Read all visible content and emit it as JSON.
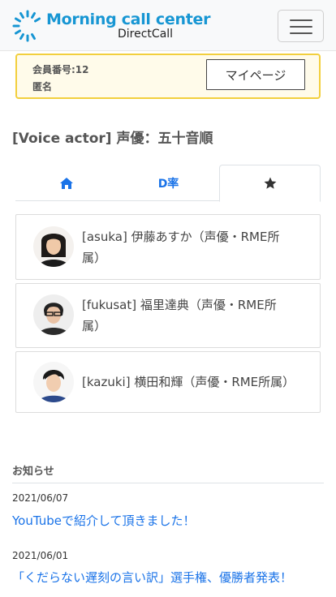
{
  "header": {
    "brand_title": "Morning call center",
    "brand_sub": "DirectCall",
    "menu_icon": "hamburger-icon"
  },
  "member": {
    "number": "会員番号:12",
    "name": "匿名",
    "mypage_label": "マイページ"
  },
  "page_title": "[Voice actor] 声優：五十音順",
  "tabs": [
    {
      "icon": "home-icon",
      "label": ""
    },
    {
      "icon": "",
      "label": "D率"
    },
    {
      "icon": "star-icon",
      "label": "",
      "active": true
    }
  ],
  "actors": [
    {
      "text": "[asuka] 伊藤あすか（声優・RME所属）",
      "avatar": "avatar-asuka"
    },
    {
      "text": "[fukusat] 福里達典（声優・RME所属）",
      "avatar": "avatar-fukusat"
    },
    {
      "text": "[kazuki] 横田和輝（声優・RME所属）",
      "avatar": "avatar-kazuki"
    }
  ],
  "news": {
    "heading": "お知らせ",
    "items": [
      {
        "date": "2021/06/07",
        "title": "YouTubeで紹介して頂きました！"
      },
      {
        "date": "2021/06/01",
        "title": "「くだらない遅刻の言い訳」選手権、優勝者発表！"
      }
    ]
  },
  "colors": {
    "brand": "#1796d3",
    "link": "#1a73e8",
    "member_border": "#f2cf3d"
  }
}
